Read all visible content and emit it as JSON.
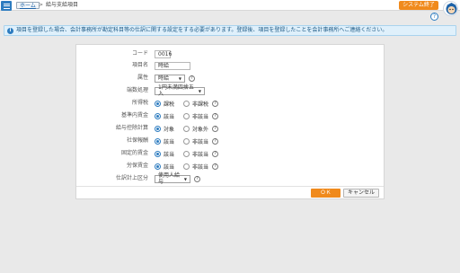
{
  "header": {
    "breadcrumb_home": "ホーム",
    "breadcrumb_sep": ">",
    "breadcrumb_current": "給与支給項目",
    "exit_label": "システム終了",
    "help_glyph": "?"
  },
  "info": {
    "icon": "i",
    "message": "項目を登録した場合、会計事務所が勘定科目等の仕訳に関する設定をする必要があります。登録後、項目を登録したことを会計事務所へご連絡ください。"
  },
  "form": {
    "code": {
      "label": "コード",
      "value": "0016"
    },
    "item_name": {
      "label": "項目名",
      "value": "時給"
    },
    "attribute": {
      "label": "属性",
      "value": "時給"
    },
    "rounding": {
      "label": "端数処理",
      "value": "1円未満四捨五入"
    },
    "income_tax": {
      "label": "所得税",
      "opt1": "課税",
      "opt2": "非課税"
    },
    "base_wage": {
      "label": "基準内賃金",
      "opt1": "該当",
      "opt2": "非該当"
    },
    "salary_deduction": {
      "label": "給与控除計算",
      "opt1": "対象",
      "opt2": "対象外"
    },
    "social_insurance": {
      "label": "社保報酬",
      "opt1": "該当",
      "opt2": "非該当"
    },
    "fixed_wage": {
      "label": "固定的賃金",
      "opt1": "該当",
      "opt2": "非該当"
    },
    "labor_insurance": {
      "label": "労保賃金",
      "opt1": "該当",
      "opt2": "非該当"
    },
    "journal_category": {
      "label": "仕訳計上区分",
      "value": "使用人給与"
    }
  },
  "actions": {
    "ok_label": "ＯＫ",
    "cancel_label": "キャンセル"
  },
  "colors": {
    "accent": "#2d7cc0",
    "orange": "#f08a1c",
    "info_bg": "#dff0fb"
  }
}
